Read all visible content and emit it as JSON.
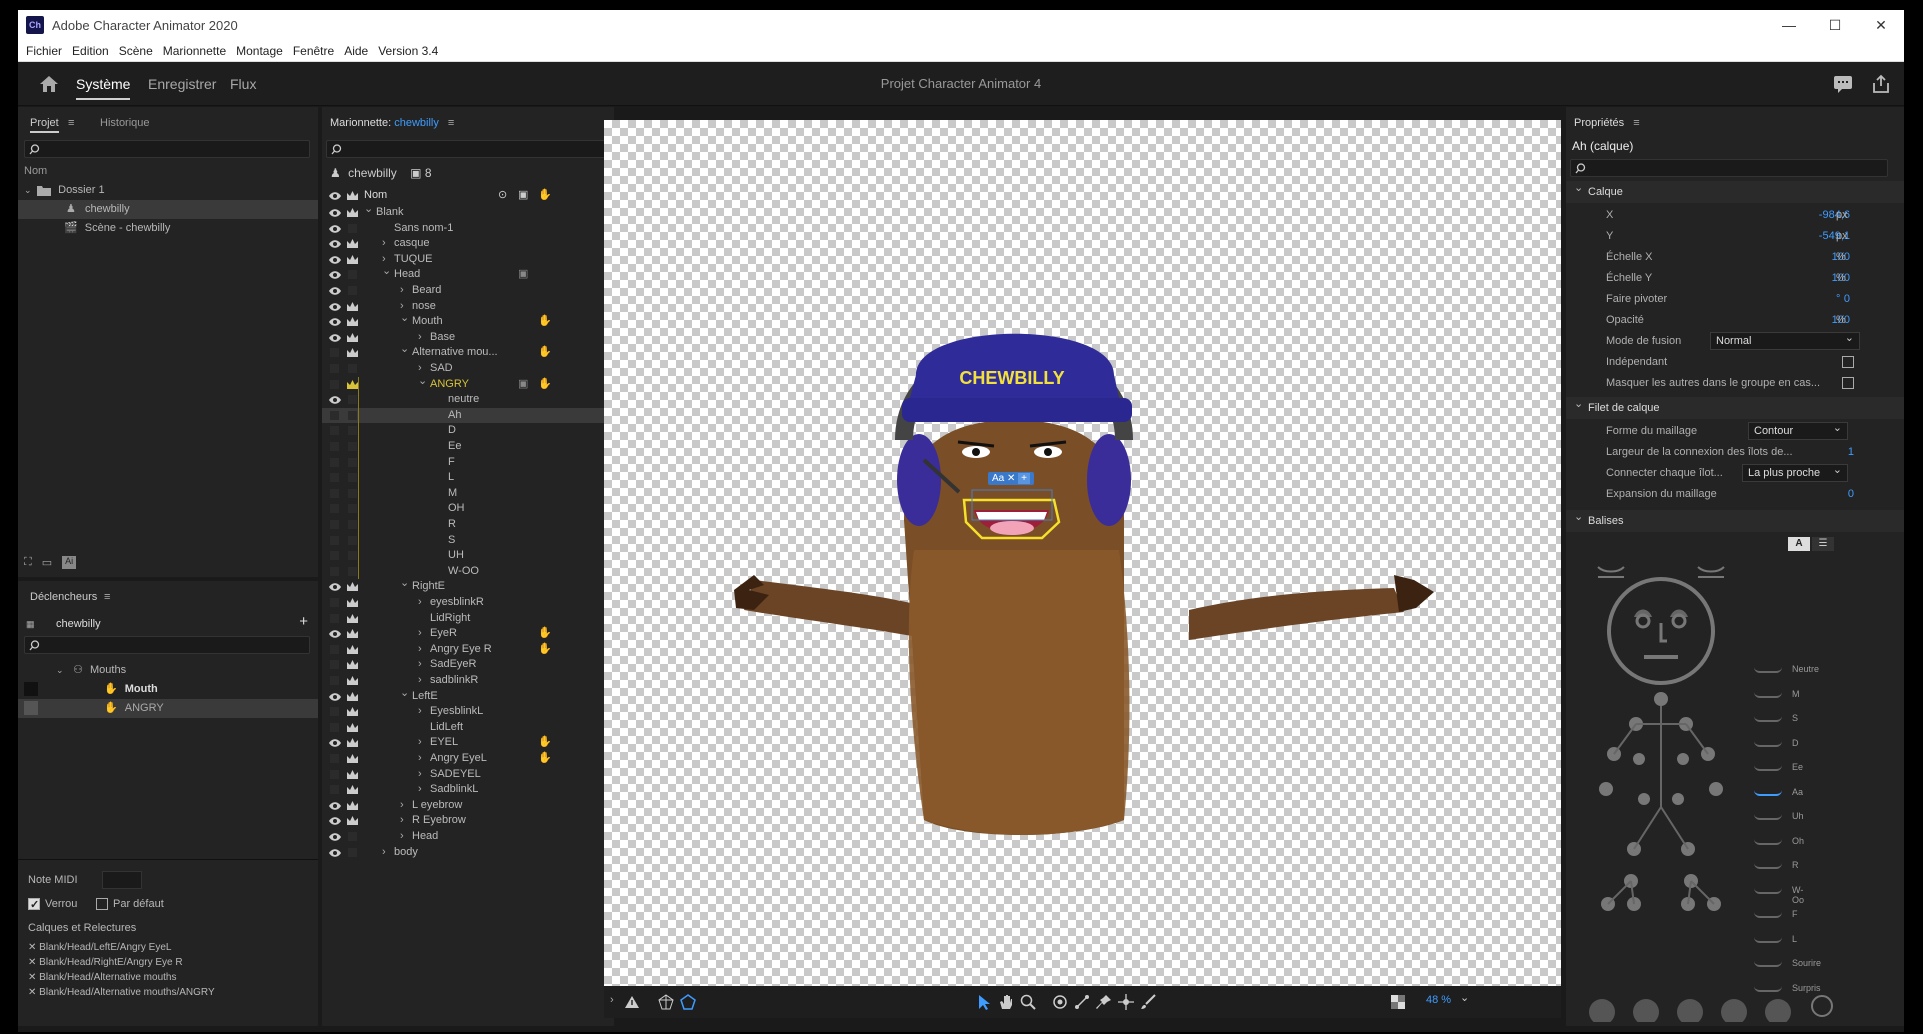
{
  "window": {
    "title": "Adobe Character Animator 2020",
    "logo": "Ch",
    "controls": [
      "—",
      "☐",
      "✕"
    ]
  },
  "menu": [
    "Fichier",
    "Edition",
    "Scène",
    "Marionnette",
    "Montage",
    "Fenêtre",
    "Aide",
    "Version 3.4"
  ],
  "workspace": {
    "tabs": [
      "Système",
      "Enregistrer",
      "Flux"
    ],
    "active_tab": "Système",
    "project_title": "Projet Character Animator 4"
  },
  "project_panel": {
    "tabs": [
      "Projet",
      "Historique"
    ],
    "column": "Nom",
    "items": [
      {
        "label": "Dossier 1",
        "icon": "folder-icon"
      },
      {
        "label": "chewbilly",
        "icon": "puppet-icon"
      },
      {
        "label": "Scène - chewbilly",
        "icon": "scene-icon"
      }
    ]
  },
  "triggers_panel": {
    "title": "Déclencheurs",
    "puppet": "chewbilly",
    "items": [
      {
        "label": "Mouths"
      },
      {
        "label": "Mouth"
      },
      {
        "label": "ANGRY"
      }
    ],
    "midi_label": "Note MIDI",
    "verrou_label": "Verrou",
    "par_defaut_label": "Par défaut",
    "calques_title": "Calques et Relectures",
    "calques": [
      "Blank/Head/LeftE/Angry EyeL",
      "Blank/Head/RightE/Angry Eye R",
      "Blank/Head/Alternative mouths",
      "Blank/Head/Alternative mouths/ANGRY"
    ]
  },
  "puppet_panel": {
    "title_prefix": "Marionnette:",
    "puppet_name": "chewbilly",
    "header_name": "chewbilly",
    "count": "8",
    "column": "Nom",
    "layers": [
      {
        "label": "Blank"
      },
      {
        "label": "Sans nom-1"
      },
      {
        "label": "casque"
      },
      {
        "label": "TUQUE"
      },
      {
        "label": "Head"
      },
      {
        "label": "Beard"
      },
      {
        "label": "nose"
      },
      {
        "label": "Mouth"
      },
      {
        "label": "Base"
      },
      {
        "label": "Alternative mou..."
      },
      {
        "label": "SAD"
      },
      {
        "label": "ANGRY"
      },
      {
        "label": "neutre"
      },
      {
        "label": "Ah"
      },
      {
        "label": "D"
      },
      {
        "label": "Ee"
      },
      {
        "label": "F"
      },
      {
        "label": "L"
      },
      {
        "label": "M"
      },
      {
        "label": "OH"
      },
      {
        "label": "R"
      },
      {
        "label": "S"
      },
      {
        "label": "UH"
      },
      {
        "label": "W-OO"
      },
      {
        "label": "RightE"
      },
      {
        "label": "eyesblinkR"
      },
      {
        "label": "LidRight"
      },
      {
        "label": "EyeR"
      },
      {
        "label": "Angry Eye R"
      },
      {
        "label": "SadEyeR"
      },
      {
        "label": "sadblinkR"
      },
      {
        "label": "LeftE"
      },
      {
        "label": "EyesblinkL"
      },
      {
        "label": "LidLeft"
      },
      {
        "label": "EYEL"
      },
      {
        "label": "Angry EyeL"
      },
      {
        "label": "SADEYEL"
      },
      {
        "label": "SadblinkL"
      },
      {
        "label": "L eyebrow"
      },
      {
        "label": "R Eyebrow"
      },
      {
        "label": "Head"
      },
      {
        "label": "body"
      }
    ]
  },
  "canvas": {
    "hat_text": "CHEWBILLY",
    "handle_label": "Aa",
    "zoom": "48 %"
  },
  "properties": {
    "title": "Propriétés",
    "layer_title": "Ah (calque)",
    "calque_section": "Calque",
    "x_label": "X",
    "x_val": "-984,6",
    "x_unit": "px",
    "y_label": "Y",
    "y_val": "-549,1",
    "y_unit": "px",
    "sx_label": "Échelle X",
    "sx_val": "100",
    "sx_unit": "%",
    "sy_label": "Échelle Y",
    "sy_val": "100",
    "sy_unit": "%",
    "rot_label": "Faire pivoter",
    "rot_val": "0",
    "rot_unit": "°",
    "op_label": "Opacité",
    "op_val": "100",
    "op_unit": "%",
    "blend_label": "Mode de fusion",
    "blend_val": "Normal",
    "indep_label": "Indépendant",
    "mask_label": "Masquer les autres dans le groupe en cas...",
    "mesh_section": "Filet de calque",
    "mesh_shape_label": "Forme du maillage",
    "mesh_shape_val": "Contour",
    "width_label": "Largeur de la connexion des îlots de...",
    "width_val": "1",
    "connect_label": "Connecter chaque îlot...",
    "connect_val": "La plus proche",
    "expand_label": "Expansion du maillage",
    "expand_val": "0",
    "tags_section": "Balises",
    "tags_mode": "A",
    "visemes": [
      "Neutre",
      "M",
      "S",
      "D",
      "Ee",
      "Aa",
      "Uh",
      "Oh",
      "R",
      "W-Oo",
      "F",
      "L",
      "Sourire",
      "Surpris"
    ],
    "active_viseme": "Aa",
    "accent": "#3f9cff"
  }
}
